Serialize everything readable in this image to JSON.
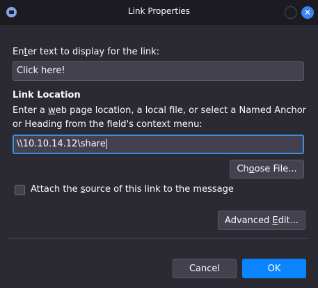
{
  "window": {
    "title": "Link Properties",
    "close_glyph": "✕",
    "app_icon": "thunderbird-icon"
  },
  "display_text": {
    "label_pre": "En",
    "label_accel": "t",
    "label_post": "er text to display for the link:",
    "value": "Click here!"
  },
  "location": {
    "heading": "Link Location",
    "help_line1_pre": "Enter a ",
    "help_line1_accel": "w",
    "help_line1_post": "eb page location, a local file, or select a Named Anchor",
    "help_line2": "or Heading from the field's context menu:",
    "value": "\\\\10.10.14.12\\share"
  },
  "choose_file": {
    "label_pre": "Ch",
    "label_accel": "o",
    "label_post": "ose File..."
  },
  "attach_source": {
    "label_pre": "Attach the ",
    "label_accel": "s",
    "label_post": "ource of this link to the message",
    "checked": false
  },
  "advanced_edit": {
    "label_pre": "Advanced ",
    "label_accel": "E",
    "label_post": "dit..."
  },
  "footer": {
    "cancel_label": "Cancel",
    "ok_label": "OK"
  },
  "colors": {
    "accent": "#0a84ff",
    "background": "#2b2a33",
    "titlebar": "#1c1b22",
    "field": "#42414d"
  }
}
